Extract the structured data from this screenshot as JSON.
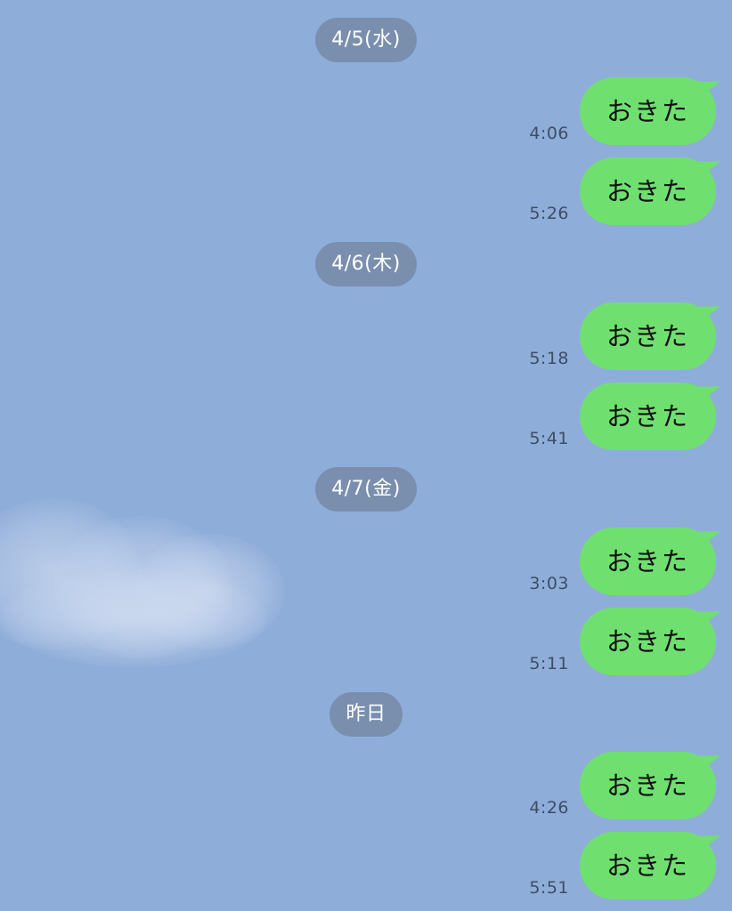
{
  "chat": {
    "groups": [
      {
        "date": "4/5(水)",
        "messages": [
          {
            "time": "4:06",
            "text": "おきた"
          },
          {
            "time": "5:26",
            "text": "おきた"
          }
        ]
      },
      {
        "date": "4/6(木)",
        "messages": [
          {
            "time": "5:18",
            "text": "おきた"
          },
          {
            "time": "5:41",
            "text": "おきた"
          }
        ]
      },
      {
        "date": "4/7(金)",
        "messages": [
          {
            "time": "3:03",
            "text": "おきた"
          },
          {
            "time": "5:11",
            "text": "おきた"
          }
        ]
      },
      {
        "date": "昨日",
        "messages": [
          {
            "time": "4:26",
            "text": "おきた"
          },
          {
            "time": "5:51",
            "text": "おきた"
          }
        ]
      }
    ]
  },
  "colors": {
    "background": "#8fadd9",
    "bubble": "#6fe070",
    "date_pill": "#7a8fae"
  }
}
